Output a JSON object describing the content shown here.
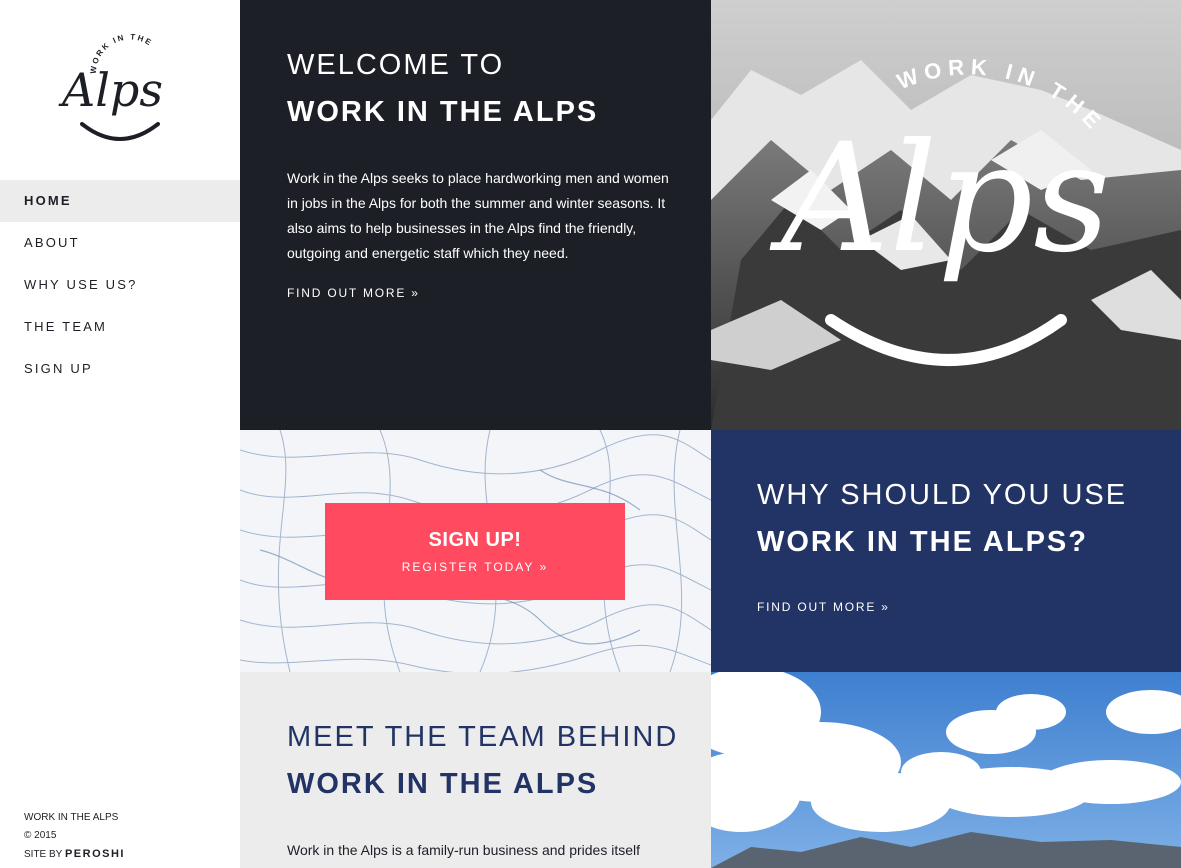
{
  "logo": {
    "small_text": "WORK IN THE",
    "script_text": "Alps"
  },
  "nav": {
    "items": [
      {
        "label": "HOME"
      },
      {
        "label": "ABOUT"
      },
      {
        "label": "WHY USE US?"
      },
      {
        "label": "THE TEAM"
      },
      {
        "label": "SIGN UP"
      }
    ]
  },
  "footer": {
    "line1": "WORK IN THE ALPS",
    "line2": "© 2015",
    "site_by": "SITE BY",
    "brand": "PEROSHI"
  },
  "welcome": {
    "title_light": "WELCOME TO",
    "title_bold": "WORK IN THE ALPS",
    "body": "Work in the Alps seeks to place hardworking men and women in jobs in the Alps for both the summer and winter seasons. It also aims to help businesses in the Alps find the friendly, outgoing and energetic staff which they need.",
    "link": "FIND OUT MORE »"
  },
  "hero": {
    "logo_small_text": "WORK IN THE",
    "logo_script_text": "Alps"
  },
  "signup": {
    "title": "SIGN UP!",
    "subtitle": "REGISTER TODAY »"
  },
  "why": {
    "title_light": "WHY SHOULD YOU USE",
    "title_bold": "WORK IN THE ALPS?",
    "link": "FIND OUT MORE »"
  },
  "team": {
    "title_light": "MEET THE TEAM BEHIND",
    "title_bold": "WORK IN THE ALPS",
    "body": "Work in the Alps is a family-run business and prides itself"
  },
  "colors": {
    "dark": "#1d1f26",
    "navy": "#223465",
    "accent": "#ff4a60",
    "light_gray": "#ececec"
  }
}
